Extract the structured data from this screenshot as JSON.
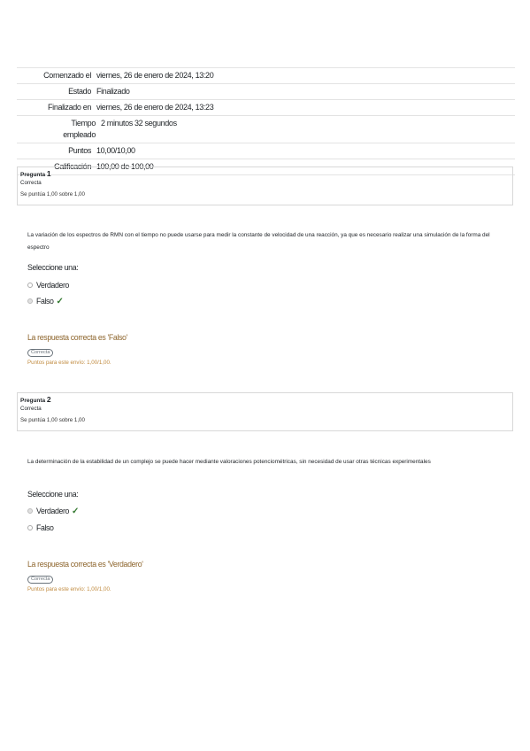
{
  "summary": {
    "rows": [
      {
        "label": "Comenzado el",
        "value": "viernes, 26 de enero de 2024, 13:20"
      },
      {
        "label": "Estado",
        "value": "Finalizado"
      },
      {
        "label": "Finalizado en",
        "value": "viernes, 26 de enero de 2024, 13:23"
      },
      {
        "label": "Tiempo empleado",
        "value": "2 minutos 32 segundos"
      },
      {
        "label": "Puntos",
        "value": "10,00/10,00"
      },
      {
        "label": "Calificación",
        "value": "100,00 de 100,00"
      }
    ]
  },
  "questions": [
    {
      "title": "Pregunta",
      "number": "1",
      "state": "Correcta",
      "mark": "Se puntúa 1,00 sobre 1,00",
      "text": "La variación de los espectros de RMN con el tiempo no puede usarse para medir la constante de velocidad de una reacción, ya que es necesario realizar una simulación de la forma del espectro",
      "prompt": "Seleccione una:",
      "options": [
        {
          "label": "Verdadero",
          "selected": false,
          "correct": false
        },
        {
          "label": "Falso",
          "selected": true,
          "correct": true
        }
      ],
      "feedback": "La respuesta correcta es 'Falso'",
      "badge": "Correcta",
      "points": "Puntos para este envío: 1,00/1,00."
    },
    {
      "title": "Pregunta",
      "number": "2",
      "state": "Correcta",
      "mark": "Se puntúa 1,00 sobre 1,00",
      "text": "La determinación de la estabilidad de un complejo se puede hacer mediante valoraciones potenciométricas, sin necesidad de usar otras técnicas experimentales",
      "prompt": "Seleccione una:",
      "options": [
        {
          "label": "Verdadero",
          "selected": true,
          "correct": true
        },
        {
          "label": "Falso",
          "selected": false,
          "correct": false
        }
      ],
      "feedback": "La respuesta correcta es 'Verdadero'",
      "badge": "Correcta",
      "points": "Puntos para este envío: 1,00/1,00."
    }
  ],
  "colors": {
    "feedback": "#8e662e",
    "points": "#c08a3e",
    "check": "#357a32"
  },
  "icons": {
    "check": "check-icon",
    "radio": "radio-icon"
  }
}
